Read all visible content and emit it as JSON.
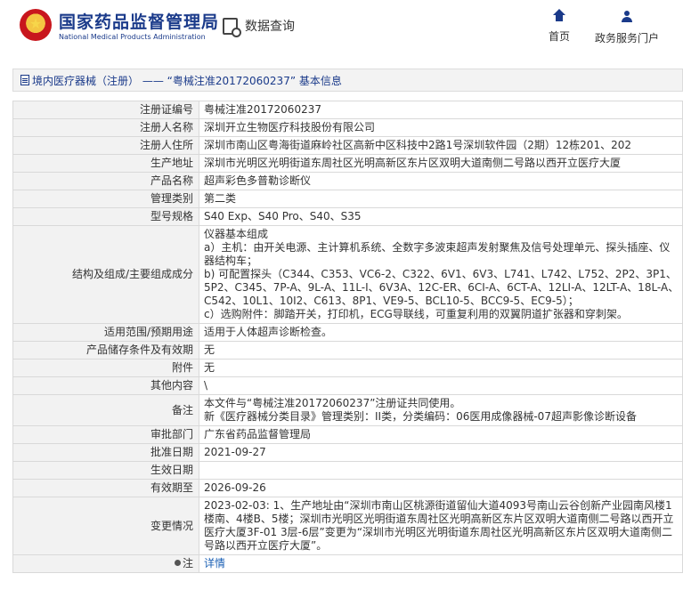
{
  "header": {
    "brand_cn": "国家药品监督管理局",
    "brand_en": "National Medical Products Administration",
    "query_label": "数据查询",
    "nav": [
      {
        "label": "首页",
        "icon": "home-icon"
      },
      {
        "label": "政务服务门户",
        "icon": "user-icon"
      }
    ]
  },
  "title_bar": {
    "text": "境内医疗器械（注册） —— “粤械注准20172060237” 基本信息"
  },
  "rows": [
    {
      "key": "注册证编号",
      "value": "粤械注准20172060237"
    },
    {
      "key": "注册人名称",
      "value": "深圳开立生物医疗科技股份有限公司"
    },
    {
      "key": "注册人住所",
      "value": "深圳市南山区粤海街道麻岭社区高新中区科技中2路1号深圳软件园（2期）12栋201、202"
    },
    {
      "key": "生产地址",
      "value": "深圳市光明区光明街道东周社区光明高新区东片区双明大道南侧二号路以西开立医疗大厦"
    },
    {
      "key": "产品名称",
      "value": "超声彩色多普勒诊断仪"
    },
    {
      "key": "管理类别",
      "value": "第二类"
    },
    {
      "key": "型号规格",
      "value": "S40 Exp、S40 Pro、S40、S35"
    },
    {
      "key": "结构及组成/主要组成成分",
      "value_lines": [
        "仪器基本组成",
        "a）主机：由开关电源、主计算机系统、全数字多波束超声发射聚焦及信号处理单元、探头插座、仪器结构车；",
        "b) 可配置探头（C344、C353、VC6-2、C322、6V1、6V3、L741、L742、L752、2P2、3P1、5P2、C345、7P-A、9L-A、11L-I、6V3A、12C-ER、6CI-A、6CT-A、12LI-A、12LT-A、18L-A、C542、10L1、10I2、C613、8P1、VE9-5、BCL10-5、BCC9-5、EC9-5）；",
        "c）选购附件：脚踏开关，打印机，ECG导联线，可重复利用的双翼阴道扩张器和穿刺架。"
      ]
    },
    {
      "key": "适用范围/预期用途",
      "value": "适用于人体超声诊断检查。"
    },
    {
      "key": "产品储存条件及有效期",
      "value": "无"
    },
    {
      "key": "附件",
      "value": "无"
    },
    {
      "key": "其他内容",
      "value": "\\"
    },
    {
      "key": "备注",
      "value_lines": [
        "本文件与“粤械注准20172060237”注册证共同使用。",
        "新《医疗器械分类目录》管理类别：II类，分类编码：06医用成像器械-07超声影像诊断设备"
      ]
    },
    {
      "key": "审批部门",
      "value": "广东省药品监督管理局"
    },
    {
      "key": "批准日期",
      "value": "2021-09-27"
    },
    {
      "key": "生效日期",
      "value": ""
    },
    {
      "key": "有效期至",
      "value": "2026-09-26"
    },
    {
      "key": "变更情况",
      "value": "2023-02-03: 1、生产地址由“深圳市南山区桃源街道留仙大道4093号南山云谷创新产业园南风楼1楼南、4楼B、5楼；深圳市光明区光明街道东周社区光明高新区东片区双明大道南侧二号路以西开立医疗大厦3F-01 3层-6层”变更为“深圳市光明区光明街道东周社区光明高新区东片区双明大道南侧二号路以西开立医疗大厦”。"
    }
  ],
  "note_row": {
    "key": "注",
    "link": "详情",
    "icon": "pin-icon"
  }
}
